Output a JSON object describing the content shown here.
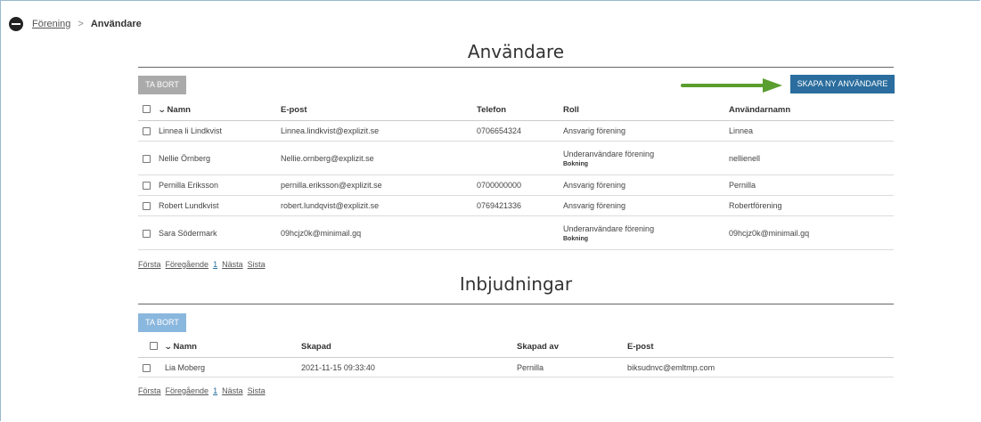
{
  "breadcrumb": {
    "parent": "Förening",
    "separator": ">",
    "current": "Användare"
  },
  "users_section": {
    "title": "Användare",
    "delete_button": "TA BORT",
    "create_button": "SKAPA NY ANVÄNDARE",
    "columns": {
      "name": "Namn",
      "email": "E-post",
      "phone": "Telefon",
      "role": "Roll",
      "username": "Användarnamn"
    },
    "rows": [
      {
        "name": "Linnea li Lindkvist",
        "email": "Linnea.lindkvist@explizit.se",
        "phone": "0706654324",
        "role": "Ansvarig förening",
        "subrole": "",
        "username": "Linnea"
      },
      {
        "name": "Nellie Örnberg",
        "email": "Nellie.ornberg@explizit.se",
        "phone": "",
        "role": "Underanvändare förening",
        "subrole": "Bokning",
        "username": "nellienell"
      },
      {
        "name": "Pernilla Eriksson",
        "email": "pernilla.eriksson@explizit.se",
        "phone": "0700000000",
        "role": "Ansvarig förening",
        "subrole": "",
        "username": "Pernilla"
      },
      {
        "name": "Robert Lundkvist",
        "email": "robert.lundqvist@explizit.se",
        "phone": "0769421336",
        "role": "Ansvarig förening",
        "subrole": "",
        "username": "Robertförening"
      },
      {
        "name": "Sara Södermark",
        "email": "09hcjz0k@minimail.gq",
        "phone": "",
        "role": "Underanvändare förening",
        "subrole": "Bokning",
        "username": "09hcjz0k@minimail.gq"
      }
    ],
    "pager": {
      "first": "Första",
      "prev": "Föregående",
      "page": "1",
      "next": "Nästa",
      "last": "Sista"
    }
  },
  "invites_section": {
    "title": "Inbjudningar",
    "delete_button": "TA BORT",
    "columns": {
      "name": "Namn",
      "created": "Skapad",
      "created_by": "Skapad av",
      "email": "E-post"
    },
    "rows": [
      {
        "name": "Lia Moberg",
        "created": "2021-11-15 09:33:40",
        "created_by": "Pernilla",
        "email": "biksudnvc@emltmp.com"
      }
    ],
    "pager": {
      "first": "Första",
      "prev": "Föregående",
      "page": "1",
      "next": "Nästa",
      "last": "Sista"
    }
  },
  "colors": {
    "primary": "#2a6d9e",
    "disabled": "#aaaaaa",
    "disabled_blue": "#8ab7de",
    "annotation_arrow": "#5a9e2f"
  }
}
